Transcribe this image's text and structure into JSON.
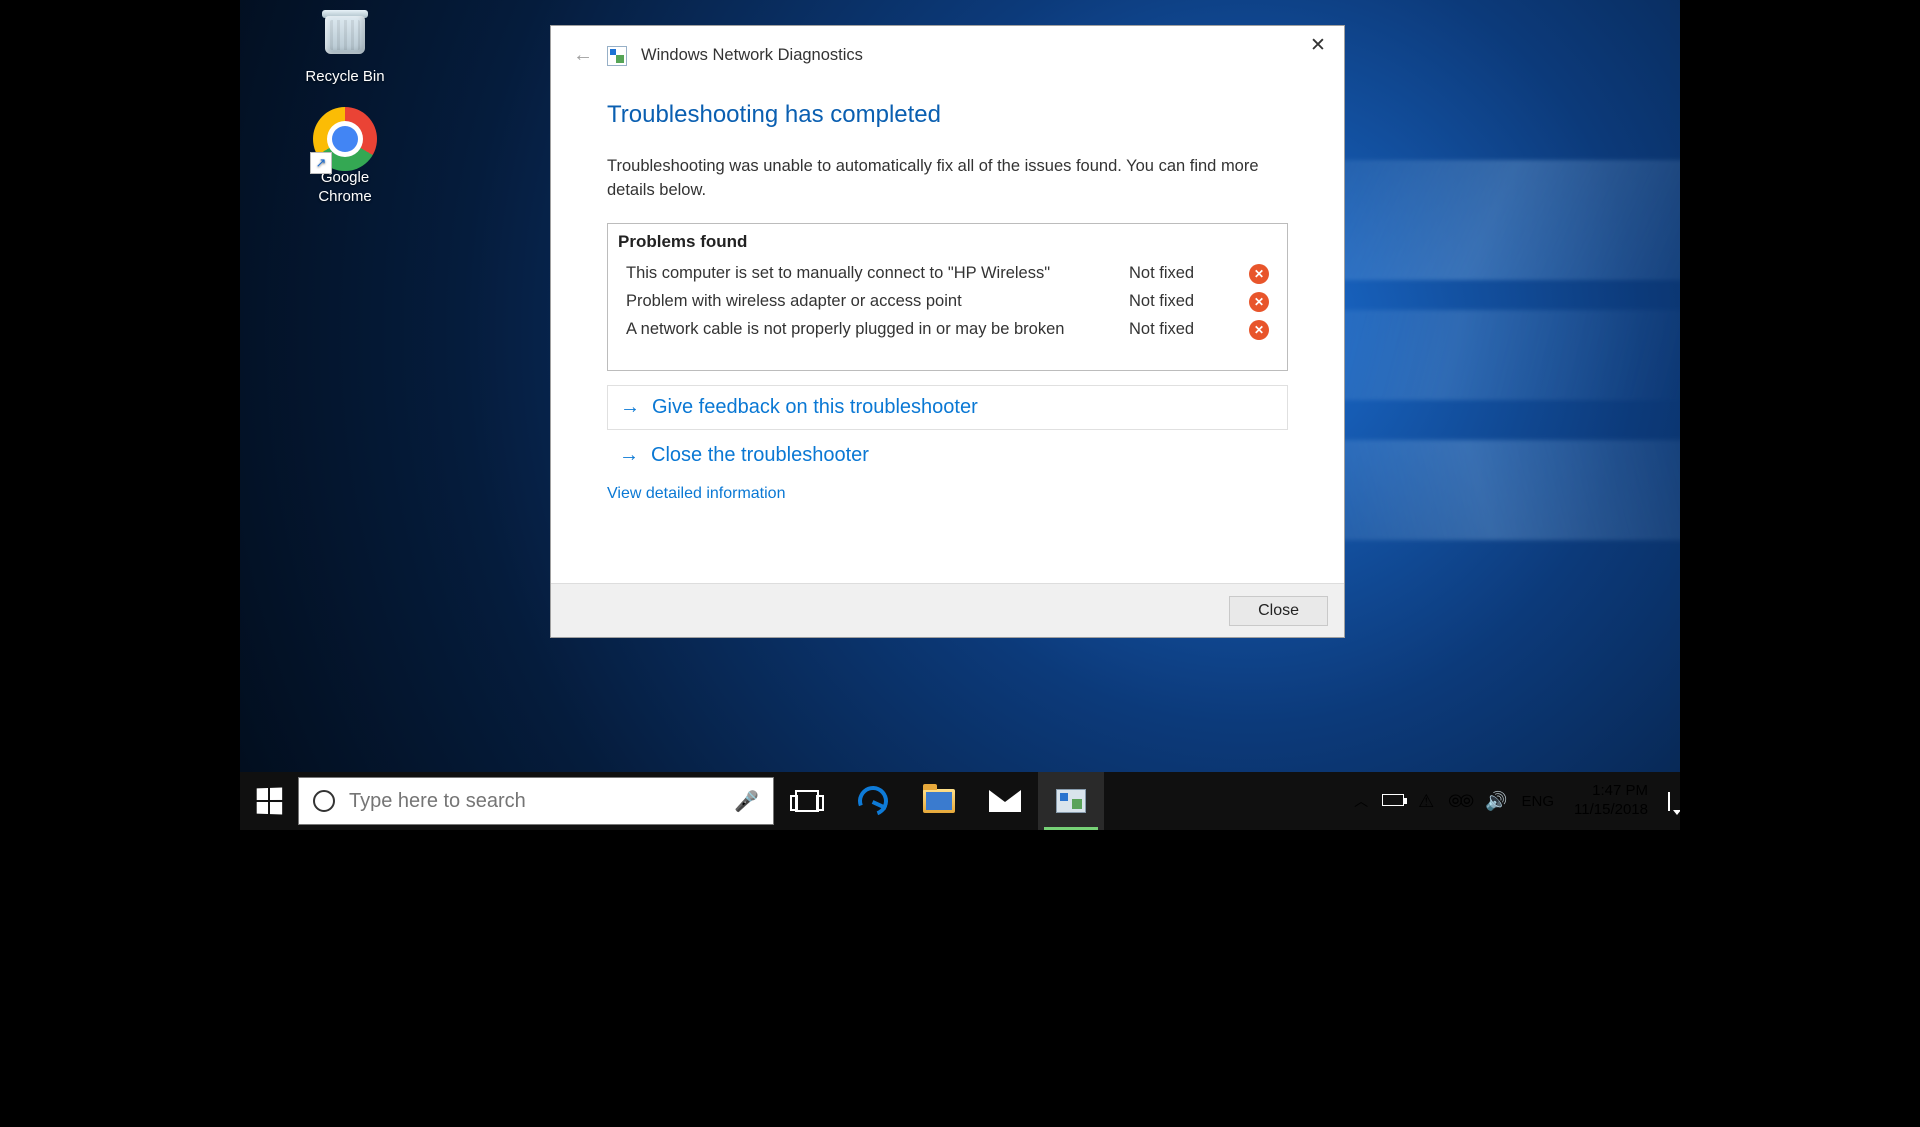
{
  "desktop": {
    "icons": {
      "recycle_bin": "Recycle Bin",
      "chrome": "Google\nChrome"
    }
  },
  "dialog": {
    "title": "Windows Network Diagnostics",
    "heading": "Troubleshooting has completed",
    "description": "Troubleshooting was unable to automatically fix all of the issues found. You can find more details below.",
    "problems_header": "Problems found",
    "problems": [
      {
        "text": "This computer is set to manually connect to \"HP Wireless\"",
        "status": "Not fixed"
      },
      {
        "text": "Problem with wireless adapter or access point",
        "status": "Not fixed"
      },
      {
        "text": "A network cable is not properly plugged in or may be broken",
        "status": "Not fixed"
      }
    ],
    "link_feedback": "Give feedback on this troubleshooter",
    "link_close": "Close the troubleshooter",
    "link_detail": "View detailed information",
    "close_button": "Close"
  },
  "taskbar": {
    "search_placeholder": "Type here to search",
    "lang": "ENG",
    "time": "1:47 PM",
    "date": "11/15/2018"
  }
}
